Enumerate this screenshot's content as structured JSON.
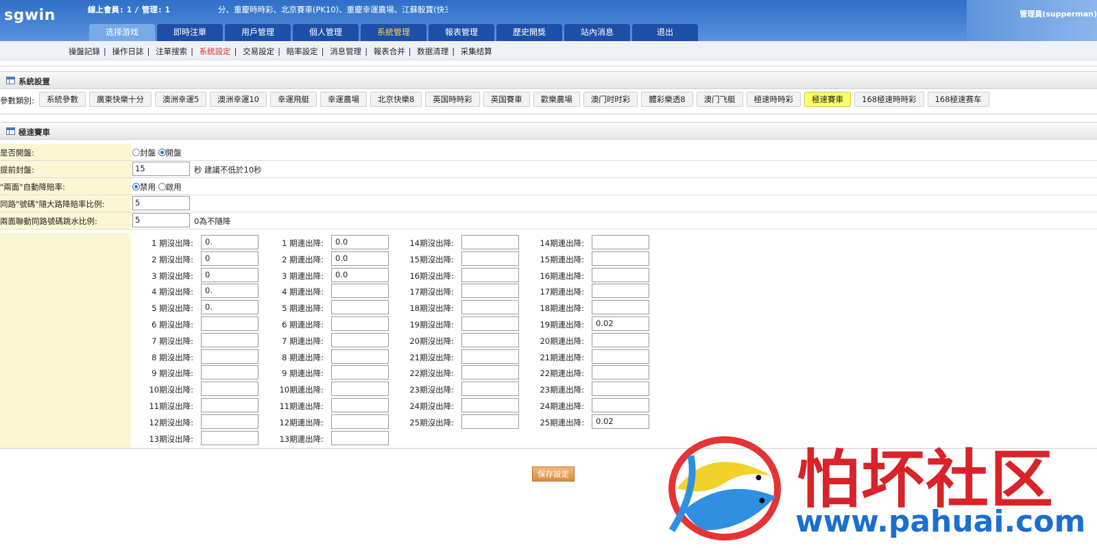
{
  "header": {
    "logo": "sgwin",
    "online_label": "線上會員:",
    "online_members": "1",
    "online_sep": "/",
    "admin_label": "管理:",
    "online_admins": "1",
    "marquee": "分、重慶時時彩、北京賽車(PK10)、重慶幸運農場、江蘇骰寶(快3",
    "user": "管理員(supperman)"
  },
  "tabs": [
    {
      "label": "选择游戏"
    },
    {
      "label": "即時注單"
    },
    {
      "label": "用戶管理"
    },
    {
      "label": "個人管理"
    },
    {
      "label": "系統管理"
    },
    {
      "label": "報表管理"
    },
    {
      "label": "歷史開獎"
    },
    {
      "label": "站內消息"
    },
    {
      "label": "退出"
    }
  ],
  "subnav": [
    {
      "label": "操盤記錄"
    },
    {
      "label": "操作日誌"
    },
    {
      "label": "注單搜索"
    },
    {
      "label": "系統設定"
    },
    {
      "label": "交易設定"
    },
    {
      "label": "賠率設定"
    },
    {
      "label": "消息管理"
    },
    {
      "label": "報表合并"
    },
    {
      "label": "数据清理"
    },
    {
      "label": "采集结算"
    }
  ],
  "system_panel": {
    "title": "系統設置",
    "category_label": "參數類別:",
    "categories": [
      "系統參數",
      "廣東快樂十分",
      "澳洲幸運5",
      "澳洲幸運10",
      "幸運飛艇",
      "幸運農場",
      "北京快樂8",
      "英国時時彩",
      "英国賽車",
      "歡樂農場",
      "澳门时时彩",
      "體彩樂透8",
      "澳门飞艇",
      "極速時時彩",
      "極速賽車",
      "168極速時時彩",
      "168極速赛车"
    ],
    "active_category": "極速賽車"
  },
  "game_panel": {
    "title": "極速賽車",
    "open": {
      "label": "是否開盤:",
      "opt_closed": "封盤",
      "opt_open": "開盤",
      "selected": "open"
    },
    "early_close": {
      "label": "提前封盤:",
      "value": "15",
      "unit": "秒",
      "hint": "建議不低於10秒"
    },
    "auto_reduce": {
      "label": "\"兩面\"自動降賠率:",
      "opt_disable": "禁用",
      "opt_enable": "啟用",
      "selected": "disable"
    },
    "same_road_ratio": {
      "label": "同路\"號碼\"隨大路降賠率比例:",
      "value": "5"
    },
    "linked_ratio": {
      "label": "兩面聯動同路號碼跳水比例:",
      "value": "5",
      "hint": "0為不隨降"
    }
  },
  "grid": {
    "col1": [
      {
        "label": "1 期沒出降:",
        "value": "0."
      },
      {
        "label": "2 期沒出降:",
        "value": "0"
      },
      {
        "label": "3 期沒出降:",
        "value": "0"
      },
      {
        "label": "4 期沒出降:",
        "value": "0."
      },
      {
        "label": "5 期沒出降:",
        "value": "0."
      },
      {
        "label": "6 期沒出降:",
        "value": ""
      },
      {
        "label": "7 期沒出降:",
        "value": ""
      },
      {
        "label": "8 期沒出降:",
        "value": ""
      },
      {
        "label": "9 期沒出降:",
        "value": ""
      },
      {
        "label": "10期沒出降:",
        "value": ""
      },
      {
        "label": "11期沒出降:",
        "value": ""
      },
      {
        "label": "12期沒出降:",
        "value": ""
      },
      {
        "label": "13期沒出降:",
        "value": ""
      }
    ],
    "col2": [
      {
        "label": "1 期連出降:",
        "value": "0.0"
      },
      {
        "label": "2 期連出降:",
        "value": "0.0"
      },
      {
        "label": "3 期連出降:",
        "value": "0.0"
      },
      {
        "label": "4 期連出降:",
        "value": ""
      },
      {
        "label": "5 期連出降:",
        "value": ""
      },
      {
        "label": "6 期連出降:",
        "value": ""
      },
      {
        "label": "7 期連出降:",
        "value": ""
      },
      {
        "label": "8 期連出降:",
        "value": ""
      },
      {
        "label": "9 期連出降:",
        "value": ""
      },
      {
        "label": "10期連出降:",
        "value": ""
      },
      {
        "label": "11期連出降:",
        "value": ""
      },
      {
        "label": "12期連出降:",
        "value": ""
      },
      {
        "label": "13期連出降:",
        "value": ""
      }
    ],
    "col3": [
      {
        "label": "14期沒出降:",
        "value": ""
      },
      {
        "label": "15期沒出降:",
        "value": ""
      },
      {
        "label": "16期沒出降:",
        "value": ""
      },
      {
        "label": "17期沒出降:",
        "value": ""
      },
      {
        "label": "18期沒出降:",
        "value": ""
      },
      {
        "label": "19期沒出降:",
        "value": ""
      },
      {
        "label": "20期沒出降:",
        "value": ""
      },
      {
        "label": "21期沒出降:",
        "value": ""
      },
      {
        "label": "22期沒出降:",
        "value": ""
      },
      {
        "label": "23期沒出降:",
        "value": ""
      },
      {
        "label": "24期沒出降:",
        "value": ""
      },
      {
        "label": "25期沒出降:",
        "value": ""
      }
    ],
    "col4": [
      {
        "label": "14期連出降:",
        "value": ""
      },
      {
        "label": "15期連出降:",
        "value": ""
      },
      {
        "label": "16期連出降:",
        "value": ""
      },
      {
        "label": "17期連出降:",
        "value": ""
      },
      {
        "label": "18期連出降:",
        "value": ""
      },
      {
        "label": "19期連出降:",
        "value": "0.02"
      },
      {
        "label": "20期連出降:",
        "value": ""
      },
      {
        "label": "21期連出降:",
        "value": ""
      },
      {
        "label": "22期連出降:",
        "value": ""
      },
      {
        "label": "23期連出降:",
        "value": ""
      },
      {
        "label": "24期連出降:",
        "value": ""
      },
      {
        "label": "25期連出降:",
        "value": "0.02"
      }
    ]
  },
  "save_label": "保存設定",
  "watermark": {
    "text": "怕坏社区",
    "url": "www.pahuai.com"
  },
  "colors": {
    "header": "#2f6fc8",
    "tab": "#1e4fa8",
    "active_sub": "#d8342a",
    "active_cat": "#ffff66",
    "label_bg": "#fbf7d4",
    "save": "#e29a52"
  }
}
